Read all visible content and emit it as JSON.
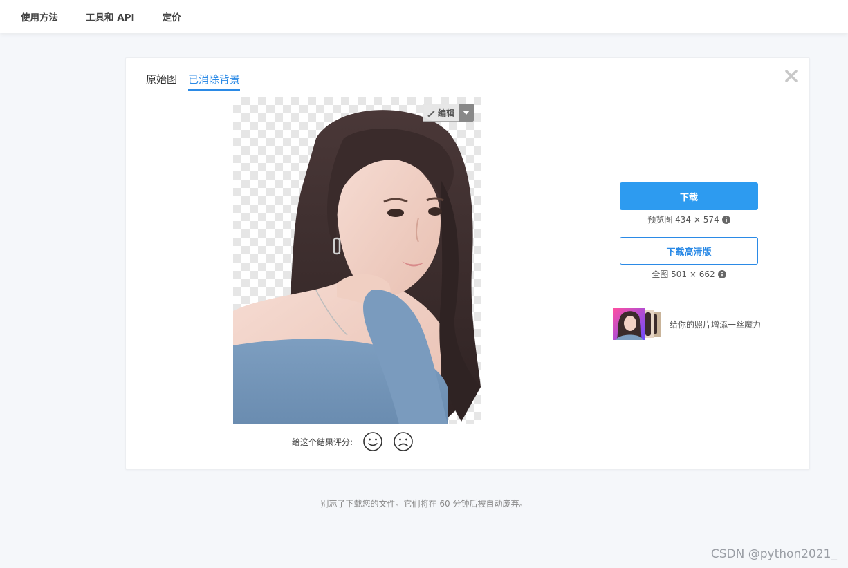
{
  "nav": {
    "items": [
      "使用方法",
      "工具和 API",
      "定价"
    ]
  },
  "tabs": [
    {
      "label": "原始图",
      "active": false
    },
    {
      "label": "已消除背景",
      "active": true
    }
  ],
  "preview": {
    "edit_label": "编辑"
  },
  "rating": {
    "label": "给这个结果评分:"
  },
  "download": {
    "primary_label": "下载",
    "preview_info": "预览图 434 × 574",
    "hd_label": "下载高清版",
    "full_info": "全图 501 × 662"
  },
  "magic": {
    "text": "给你的照片增添一丝魔力"
  },
  "notice": "别忘了下载您的文件。它们将在 60 分钟后被自动废弃。",
  "watermark": "CSDN @python2021_",
  "colors": {
    "accent": "#2d9bf0",
    "tab_active": "#2b8ae6"
  }
}
